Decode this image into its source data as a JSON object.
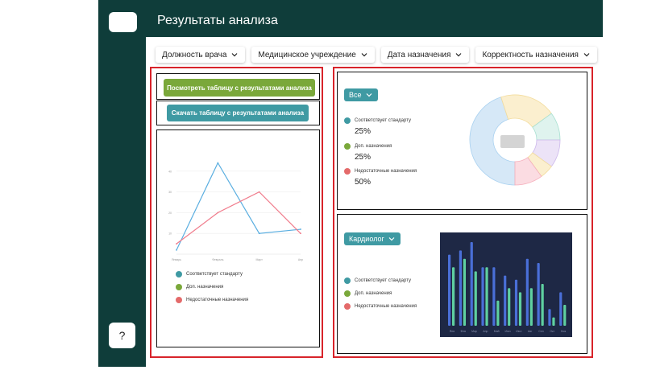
{
  "app": {
    "title": "Результаты анализа",
    "help_label": "?"
  },
  "filters": [
    {
      "label": "Должность врача"
    },
    {
      "label": "Медицинское учреждение"
    },
    {
      "label": "Дата назначения"
    },
    {
      "label": "Корректность назначения"
    }
  ],
  "actions": {
    "view_table": "Посмотреть таблицу с результатами анализа",
    "download_table": "Скачать таблицу с результатами анализа"
  },
  "legend": [
    {
      "label": "Соответствует стандарту",
      "color": "#3f9aa3"
    },
    {
      "label": "Доп. назначения",
      "color": "#7aa83a"
    },
    {
      "label": "Недостаточные назначения",
      "color": "#e46a6a"
    }
  ],
  "summary": {
    "selector": "Все",
    "percents": [
      "25%",
      "25%",
      "50%"
    ]
  },
  "by_specialty": {
    "selector": "Кардиолог"
  },
  "chart_data": [
    {
      "type": "line",
      "x": [
        "Январь",
        "Февраль",
        "Март",
        "Апр"
      ],
      "y_ticks": [
        "40",
        "30",
        "20",
        "10"
      ],
      "series": [
        {
          "values": [
            2,
            44,
            10,
            12
          ],
          "color": "#5aaee0"
        },
        {
          "values": [
            5,
            20,
            30,
            10
          ],
          "color": "#f07b8b"
        }
      ],
      "ylim": [
        0,
        50
      ]
    },
    {
      "type": "pie",
      "values": [
        45,
        20,
        10,
        10,
        5,
        10
      ],
      "colors": [
        "#d6e8f7",
        "#fbefcf",
        "#dff3ee",
        "#ece3f7",
        "#fbefcf",
        "#fbdce2"
      ]
    },
    {
      "type": "bar",
      "categories": [
        "Янв",
        "Фев",
        "Мар",
        "Апр",
        "Май",
        "Июн",
        "Июл",
        "Авг",
        "Сен",
        "Окт",
        "Ноя"
      ],
      "series": [
        {
          "values": [
            85,
            90,
            100,
            70,
            70,
            60,
            55,
            80,
            75,
            20,
            40
          ]
        },
        {
          "values": [
            70,
            80,
            65,
            70,
            30,
            45,
            40,
            45,
            50,
            10,
            25
          ]
        }
      ],
      "colors": [
        "#4a6fd8",
        "#5fd0a0"
      ],
      "ylim": [
        0,
        100
      ]
    }
  ]
}
